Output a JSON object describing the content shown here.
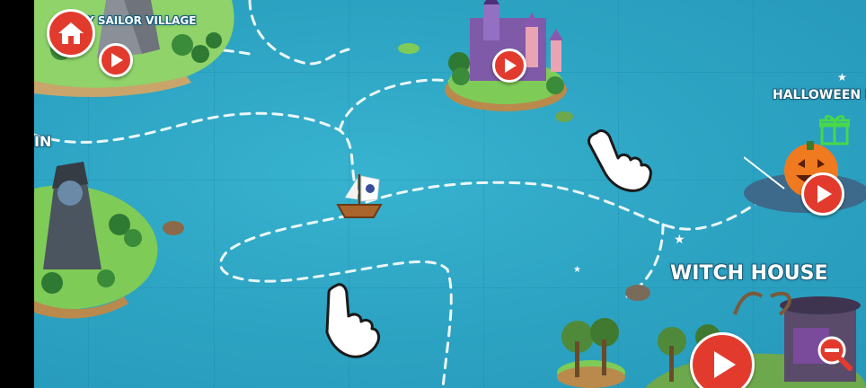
{
  "labels": {
    "sailor_village": "Y SAILOR VILLAGE",
    "left_partial": "IN",
    "halloween": "HALLOWEEN MA",
    "witch_house": "WITCH HOUSE"
  },
  "icons": {
    "home": "home-icon",
    "play": "play-icon",
    "zoom_out": "zoom-out-icon",
    "tap_hand": "tap-hand-icon",
    "gift": "gift-icon",
    "boat": "sailboat-icon"
  },
  "colors": {
    "sea": "#2ea5c4",
    "button_red": "#e23b2e",
    "path_white": "#ffffff"
  }
}
